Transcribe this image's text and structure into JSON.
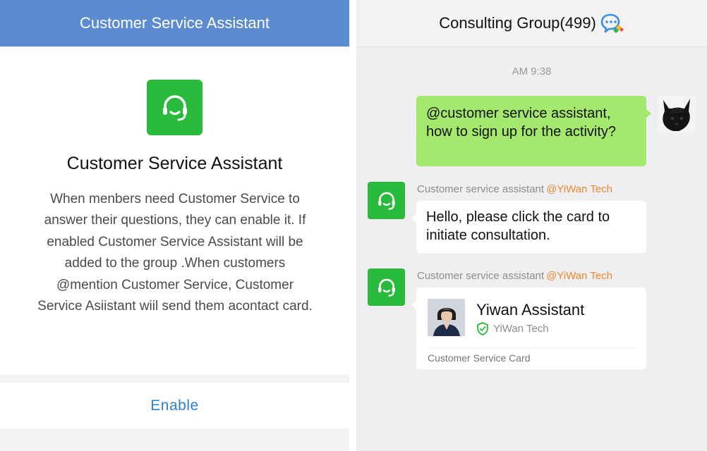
{
  "left": {
    "header_title": "Customer Service Assistant",
    "icon": "headset-icon",
    "title": "Customer Service Assistant",
    "description": "When menbers need Customer Service to answer their questions, they can enable it. If enabled Customer Service Assistant will be added to the group .When customers @mention Customer Service, Customer Service Asiistant wiil send them acontact card.",
    "enable_label": "Enable"
  },
  "right": {
    "header_title": "Consulting Group(499)",
    "header_icon": "group-chat-icon",
    "timestamp": "AM 9:38",
    "messages": [
      {
        "type": "outgoing",
        "text": "@customer service assistant, how to sign up for the activity?"
      },
      {
        "type": "incoming",
        "sender": "Customer service assistant",
        "sender_org": "@YiWan Tech",
        "text": "Hello, please click the card to initiate consultation."
      },
      {
        "type": "incoming-card",
        "sender": "Customer service assistant",
        "sender_org": "@YiWan Tech",
        "card": {
          "name": "Yiwan Assistant",
          "company": "YiWan Tech",
          "verified_icon": "shield-check-icon",
          "footer": "Customer Service Card"
        }
      }
    ]
  },
  "colors": {
    "header_blue": "#5b8ccf",
    "brand_green": "#2aba3c",
    "bubble_green": "#a4e86d",
    "link_blue": "#2f7fd8",
    "mention_orange": "#f0872c"
  }
}
